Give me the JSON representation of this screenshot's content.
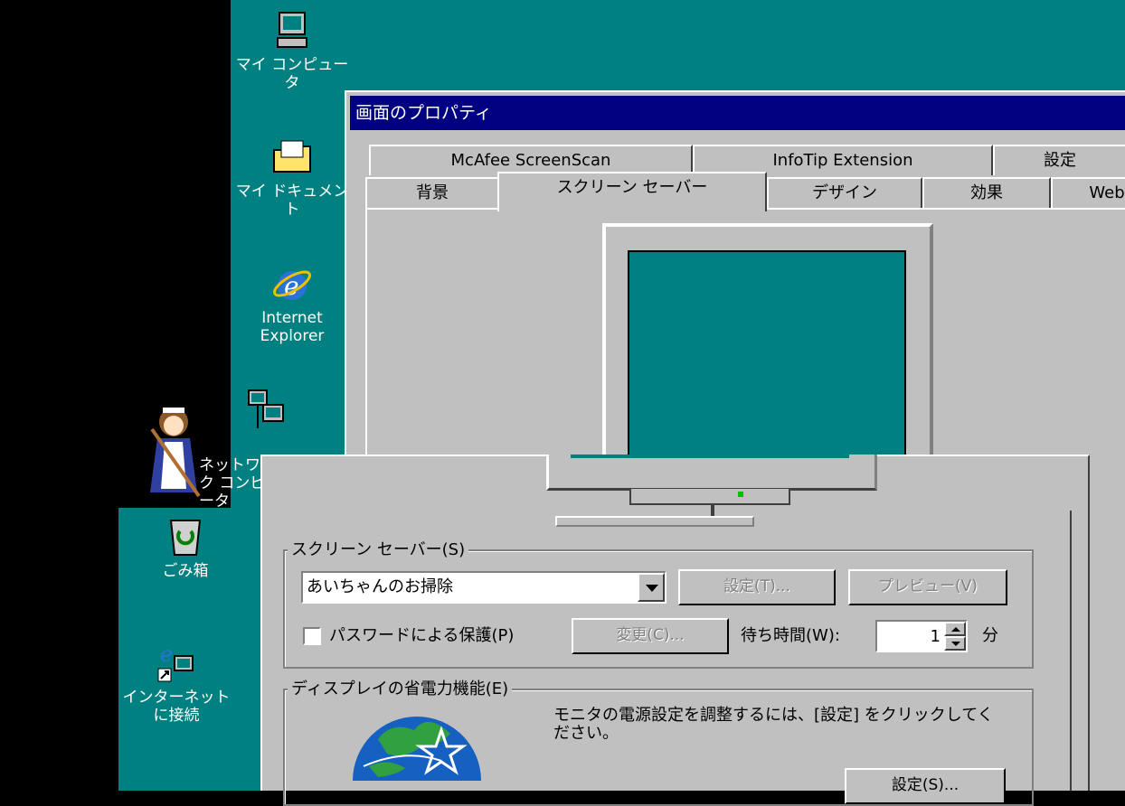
{
  "desktop": {
    "icons": [
      {
        "label": "マイ コンピュータ"
      },
      {
        "label": "マイ ドキュメント"
      },
      {
        "label": "Internet Explorer"
      },
      {
        "label": "ネットワーク コンピュータ"
      },
      {
        "label": "ごみ箱"
      },
      {
        "label": "インターネット に接続"
      }
    ]
  },
  "window": {
    "title": "画面のプロパティ",
    "tabs_row1": [
      {
        "label": "McAfee ScreenScan"
      },
      {
        "label": "InfoTip Extension"
      },
      {
        "label": "設定"
      }
    ],
    "tabs_row2": [
      {
        "label": "背景"
      },
      {
        "label": "スクリーン セーバー",
        "selected": true
      },
      {
        "label": "デザイン"
      },
      {
        "label": "効果"
      },
      {
        "label": "Web"
      }
    ],
    "screensaver": {
      "group_label": "スクリーン セーバー(S)",
      "selected": "あいちゃんのお掃除",
      "settings_button": "設定(T)...",
      "preview_button": "プレビュー(V)",
      "password_label": "パスワードによる保護(P)",
      "password_checked": false,
      "change_button": "変更(C)...",
      "wait_label": "待ち時間(W):",
      "wait_value": "1",
      "wait_unit": "分"
    },
    "power": {
      "group_label": "ディスプレイの省電力機能(E)",
      "description": "モニタの電源設定を調整するには、[設定] をクリックしてください。",
      "settings_button": "設定(S)..."
    }
  },
  "colors": {
    "desktop": "#008080",
    "face": "#c0c0c0",
    "title": "#000080"
  }
}
